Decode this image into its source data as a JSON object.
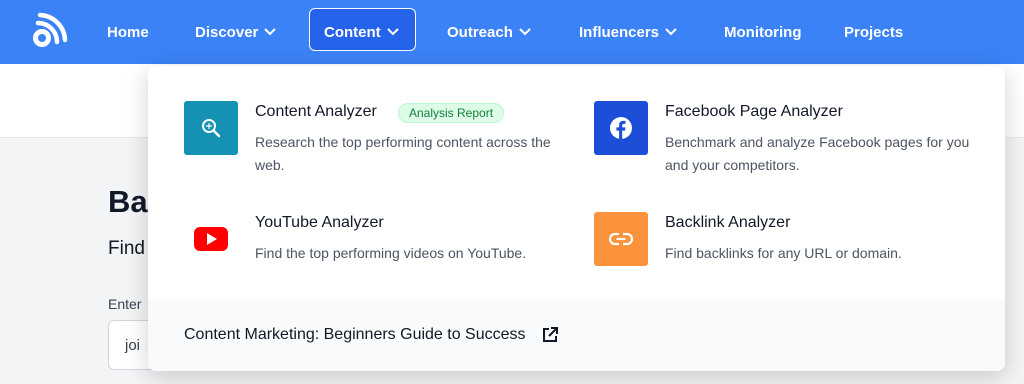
{
  "nav": {
    "logo_icon": "rss-logo-icon",
    "items": [
      {
        "label": "Home",
        "has_chevron": false
      },
      {
        "label": "Discover",
        "has_chevron": true
      },
      {
        "label": "Content",
        "has_chevron": true,
        "active": true
      },
      {
        "label": "Outreach",
        "has_chevron": true
      },
      {
        "label": "Influencers",
        "has_chevron": true
      },
      {
        "label": "Monitoring",
        "has_chevron": false
      },
      {
        "label": "Projects",
        "has_chevron": false
      }
    ]
  },
  "background_page": {
    "heading_partial": "Ba",
    "subheading_partial": "Find",
    "input_label_partial": "Enter",
    "input_value_partial": "joi"
  },
  "dropdown": {
    "items": [
      {
        "title": "Content Analyzer",
        "badge": "Analysis Report",
        "description": "Research the top performing content across the web.",
        "icon": "search-web-icon",
        "icon_bg": "#1591b4"
      },
      {
        "title": "Facebook Page Analyzer",
        "description": "Benchmark and analyze Facebook pages for you and your competitors.",
        "icon": "facebook-icon",
        "icon_bg": "#1d4ed8"
      },
      {
        "title": "YouTube Analyzer",
        "description": "Find the top performing videos on YouTube.",
        "icon": "youtube-icon",
        "icon_bg": "#ffffff"
      },
      {
        "title": "Backlink Analyzer",
        "description": "Find backlinks for any URL or domain.",
        "icon": "link-icon",
        "icon_bg": "#fb923c"
      }
    ],
    "footer": {
      "label": "Content Marketing: Beginners Guide to Success",
      "icon": "external-link-icon"
    }
  },
  "colors": {
    "nav_bg": "#3b82f6",
    "nav_active_bg": "#2563eb",
    "youtube_red": "#ff0000"
  }
}
